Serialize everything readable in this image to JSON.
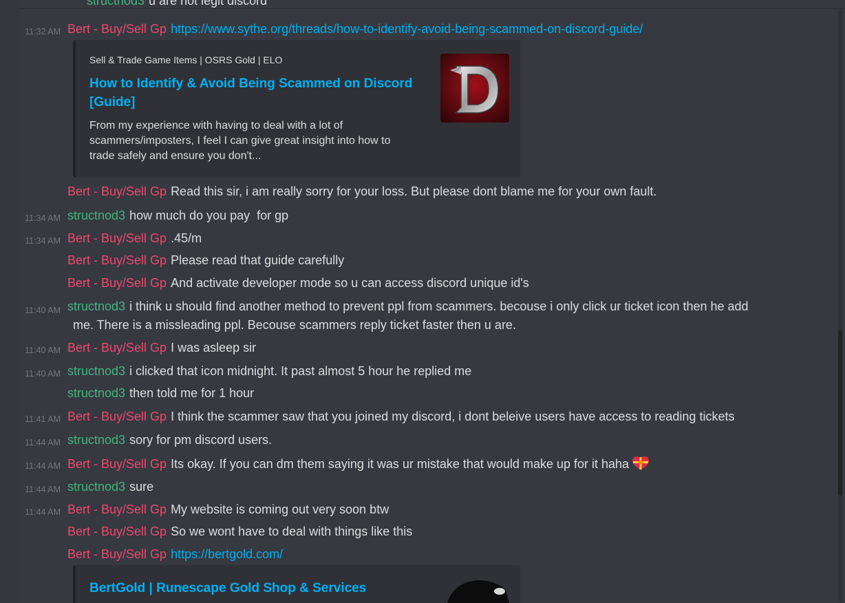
{
  "top_cut": {
    "author": "structnod3",
    "text": "u are not legit discord"
  },
  "messages": [
    {
      "ts": "11:32 AM",
      "author": "Bert - Buy/Sell Gp",
      "link": "https://www.sythe.org/threads/how-to-identify-avoid-being-scammed-on-discord-guide/"
    },
    {
      "ts": "",
      "author": "Bert - Buy/Sell Gp",
      "text": "Read this sir, i am really sorry for your loss. But please dont blame me for your own fault."
    },
    {
      "ts": "11:34 AM",
      "author": "structnod3",
      "text": "how much do you pay  for gp"
    },
    {
      "ts": "11:34 AM",
      "author": "Bert - Buy/Sell Gp",
      "text": ".45/m"
    },
    {
      "ts": "",
      "author": "Bert - Buy/Sell Gp",
      "text": "Please read that guide carefully"
    },
    {
      "ts": "",
      "author": "Bert - Buy/Sell Gp",
      "text": "And activate developer mode so u can access discord unique id's"
    },
    {
      "ts": "11:40 AM",
      "author": "structnod3",
      "text": "i think u should find another method to prevent ppl from scammers. becouse i only click ur ticket icon then he add",
      "text2": "me. There is a missleading ppl. Becouse scammers reply ticket faster then u are."
    },
    {
      "ts": "11:40 AM",
      "author": "Bert - Buy/Sell Gp",
      "text": "I was asleep sir"
    },
    {
      "ts": "11:40 AM",
      "author": "structnod3",
      "text": "i clicked that icon midnight. It past almost 5 hour he replied me"
    },
    {
      "ts": "",
      "author": "structnod3",
      "text": "then told me for 1 hour"
    },
    {
      "ts": "11:41 AM",
      "author": "Bert - Buy/Sell Gp",
      "text": "I think the scammer saw that you joined my discord, i dont beleive users have access to reading tickets"
    },
    {
      "ts": "11:44 AM",
      "author": "structnod3",
      "text": "sory for pm discord users."
    },
    {
      "ts": "11:44 AM",
      "author": "Bert - Buy/Sell Gp",
      "text": "Its okay. If you can dm them saying it was ur mistake that would make up for it haha"
    },
    {
      "ts": "11:44 AM",
      "author": "structnod3",
      "text": "sure"
    },
    {
      "ts": "11:44 AM",
      "author": "Bert - Buy/Sell Gp",
      "text": "My website is coming out very soon btw"
    },
    {
      "ts": "",
      "author": "Bert - Buy/Sell Gp",
      "text": "So we wont have to deal with things like this"
    },
    {
      "ts": "",
      "author": "Bert - Buy/Sell Gp",
      "link": "https://bertgold.com/"
    }
  ],
  "embed1": {
    "provider": "Sell & Trade Game Items | OSRS Gold | ELO",
    "title": "How to Identify & Avoid Being Scammed on Discord [Guide]",
    "description": "From my experience with having to deal with a lot of scammers/imposters, I feel I can give great insight into how to trade safely and ensure you don't...",
    "thumb_letter": "D"
  },
  "embed2": {
    "title": "BertGold | Runescape Gold Shop & Services"
  },
  "colors": {
    "bert": "#f04770",
    "struct": "#43b581",
    "link": "#00b0f4",
    "background": "#36393f",
    "embed": "#2f3136"
  },
  "icons": {
    "heart_emoji": "gift-heart-icon"
  }
}
